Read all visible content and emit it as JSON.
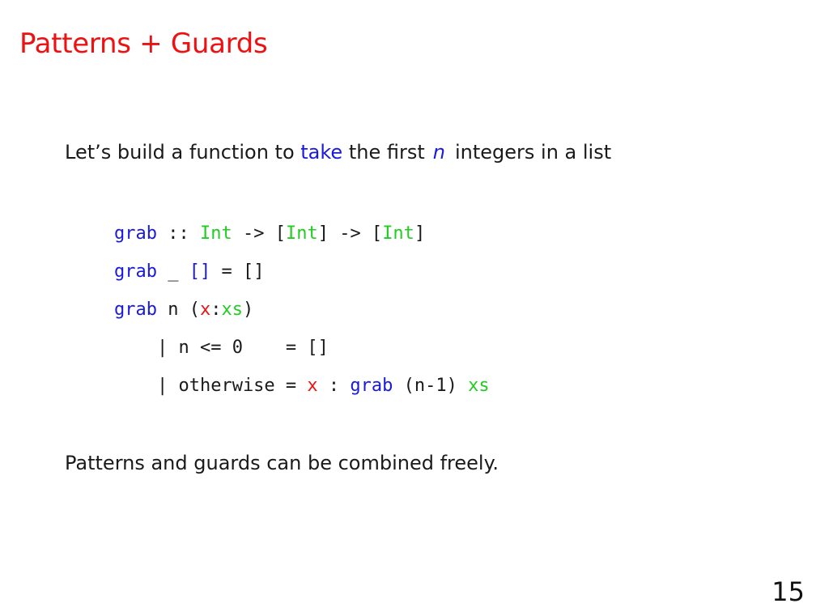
{
  "slide": {
    "title": "Patterns + Guards",
    "intro": {
      "before": "Let’s build a function to ",
      "take": "take",
      "middle": " the first",
      "n": "n",
      "after": "integers in a list"
    },
    "code": {
      "l1": {
        "fn": "grab",
        "sep1": " :: ",
        "t1": "Int",
        "arrow1": " -> [",
        "t2": "Int",
        "arrow2": "] -> [",
        "t3": "Int",
        "close": "]"
      },
      "l2": {
        "fn": "grab",
        "wild": " _ ",
        "emp": "[]",
        "rest": " = []"
      },
      "l3": {
        "fn": "grab",
        "mid": " n (",
        "x": "x",
        "colon": ":",
        "xs": "xs",
        "close": ")"
      },
      "l4": {
        "text": "    | n <= 0    = []"
      },
      "l5": {
        "pre": "    | otherwise = ",
        "x": "x",
        "mid": " : ",
        "fn": "grab",
        "args": " (n-1) ",
        "xs": "xs"
      }
    },
    "conclusion": "Patterns and guards can be combined freely.",
    "page_number": "15"
  },
  "colors": {
    "title": "#ee1111",
    "keyword_blue": "#1a1adb",
    "type_green": "#22cc22",
    "var_red": "#ee1111"
  }
}
